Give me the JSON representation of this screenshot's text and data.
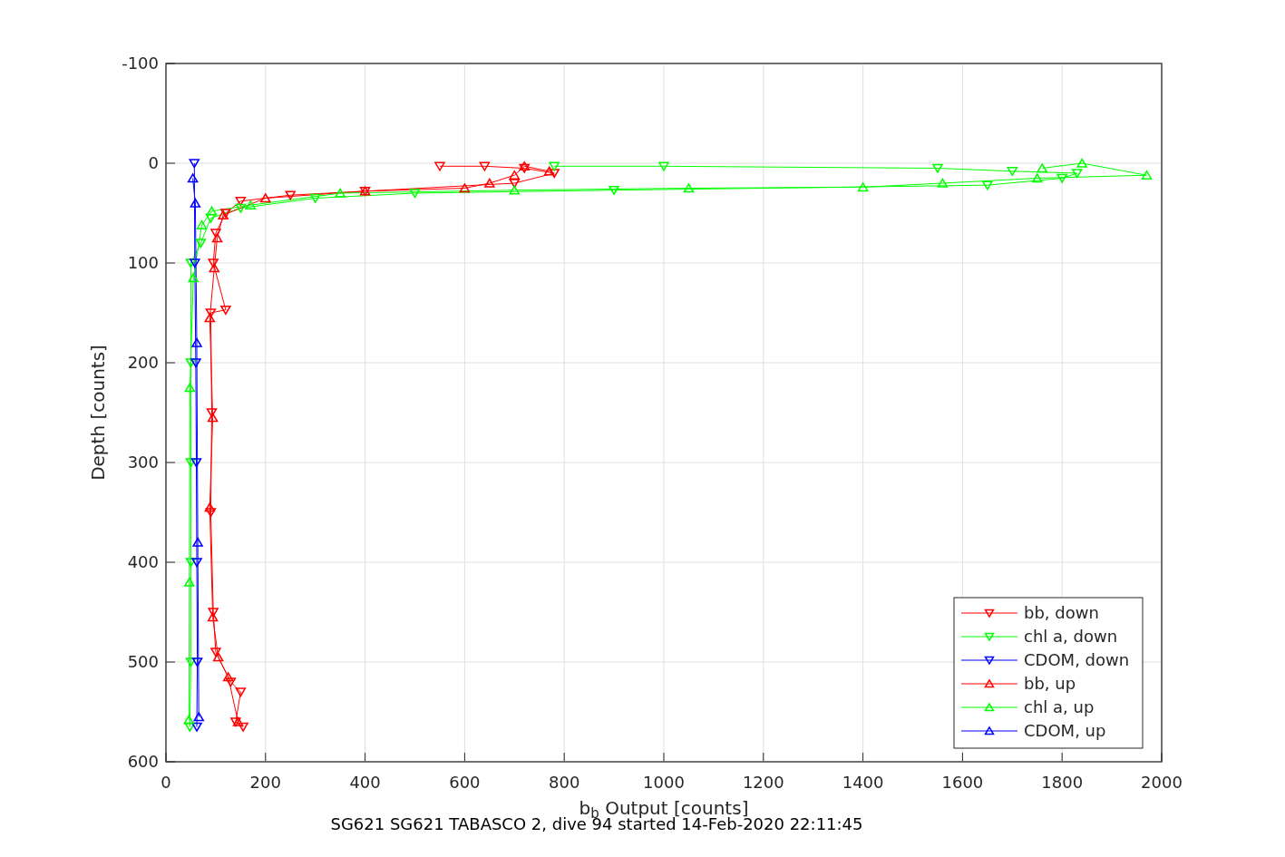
{
  "figure": {
    "chart_data": {
      "type": "line",
      "xlabel": "b$_{b}$ Output [counts]",
      "ylabel": "Depth [counts]",
      "xlim": [
        0,
        2000
      ],
      "ylim": [
        600,
        -100
      ],
      "xticks": [
        0,
        200,
        400,
        600,
        800,
        1000,
        1200,
        1400,
        1600,
        1800,
        2000
      ],
      "yticks": [
        -100,
        0,
        100,
        200,
        300,
        400,
        500,
        600
      ],
      "grid": true,
      "legend": true,
      "series": [
        {
          "name": "bb, down",
          "color": "#ff0000",
          "marker": "triangle",
          "x": [
            550,
            640,
            720,
            780,
            700,
            400,
            250,
            150,
            120,
            100,
            95,
            120,
            90,
            92,
            90,
            95,
            100,
            130,
            150,
            140,
            155
          ],
          "values": [
            3,
            3,
            5,
            10,
            20,
            28,
            32,
            38,
            50,
            70,
            100,
            147,
            150,
            250,
            350,
            450,
            490,
            520,
            530,
            560,
            565
          ]
        },
        {
          "name": "chl a, down",
          "color": "#00ff00",
          "marker": "triangle",
          "x": [
            780,
            1000,
            1550,
            1700,
            1830,
            1800,
            1650,
            900,
            500,
            300,
            150,
            90,
            70,
            50,
            50,
            50,
            50,
            50,
            48
          ],
          "values": [
            3,
            3,
            5,
            8,
            10,
            15,
            22,
            27,
            30,
            35,
            45,
            55,
            80,
            100,
            200,
            300,
            400,
            500,
            565
          ]
        },
        {
          "name": "CDOM, down",
          "color": "#0000ff",
          "marker": "triangle",
          "x": [
            57,
            58,
            60,
            61,
            62,
            63,
            62
          ],
          "values": [
            0,
            100,
            200,
            300,
            400,
            500,
            565
          ]
        },
        {
          "name": "bb, up",
          "color": "#ff0000",
          "marker": "triangle",
          "x": [
            145,
            125,
            105,
            94,
            88,
            94,
            88,
            97,
            103,
            115,
            200,
            400,
            600,
            650,
            700,
            720,
            770
          ],
          "values": [
            560,
            515,
            495,
            455,
            345,
            255,
            155,
            105,
            75,
            52,
            35,
            28,
            25,
            20,
            12,
            3,
            8
          ]
        },
        {
          "name": "chl a, up",
          "color": "#00ff00",
          "marker": "triangle",
          "x": [
            46,
            47,
            48,
            55,
            72,
            92,
            170,
            350,
            700,
            1050,
            1400,
            1560,
            1750,
            1970,
            1840,
            1760
          ],
          "values": [
            558,
            420,
            225,
            115,
            62,
            48,
            42,
            30,
            27,
            25,
            24,
            20,
            15,
            12,
            0,
            5
          ]
        },
        {
          "name": "CDOM, up",
          "color": "#0000ff",
          "marker": "triangle",
          "x": [
            66,
            64,
            62,
            59,
            54
          ],
          "values": [
            555,
            380,
            180,
            40,
            15
          ]
        }
      ]
    },
    "caption": "SG621 SG621 TABASCO 2, dive 94 started 14-Feb-2020 22:11:45"
  }
}
